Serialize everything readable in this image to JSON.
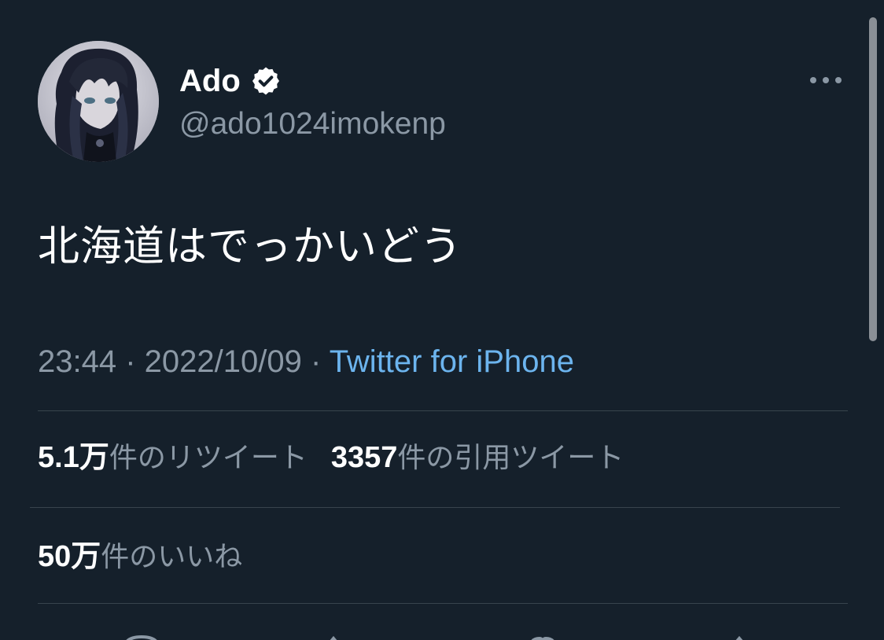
{
  "tweet": {
    "author": {
      "display_name": "Ado",
      "handle": "@ado1024imokenp",
      "verified": true
    },
    "text": "北海道はでっかいどう",
    "timestamp": {
      "time": "23:44",
      "separator1": " · ",
      "date": "2022/10/09",
      "separator2": " · ",
      "source": "Twitter for iPhone"
    },
    "stats": {
      "retweets": {
        "count": "5.1万",
        "label": "件のリツイート"
      },
      "quotes": {
        "count": "3357",
        "label": "件の引用ツイート"
      },
      "likes": {
        "count": "50万",
        "label": "件のいいね"
      }
    }
  },
  "icons": {
    "verified": "verified-badge-icon",
    "more": "more-options-icon",
    "reply": "reply-icon",
    "retweet": "retweet-icon",
    "like": "like-icon",
    "share": "share-icon"
  },
  "colors": {
    "background": "#15202b",
    "text_primary": "#ffffff",
    "text_secondary": "#8b98a5",
    "link": "#6cb4ee",
    "divider": "#38444d"
  }
}
